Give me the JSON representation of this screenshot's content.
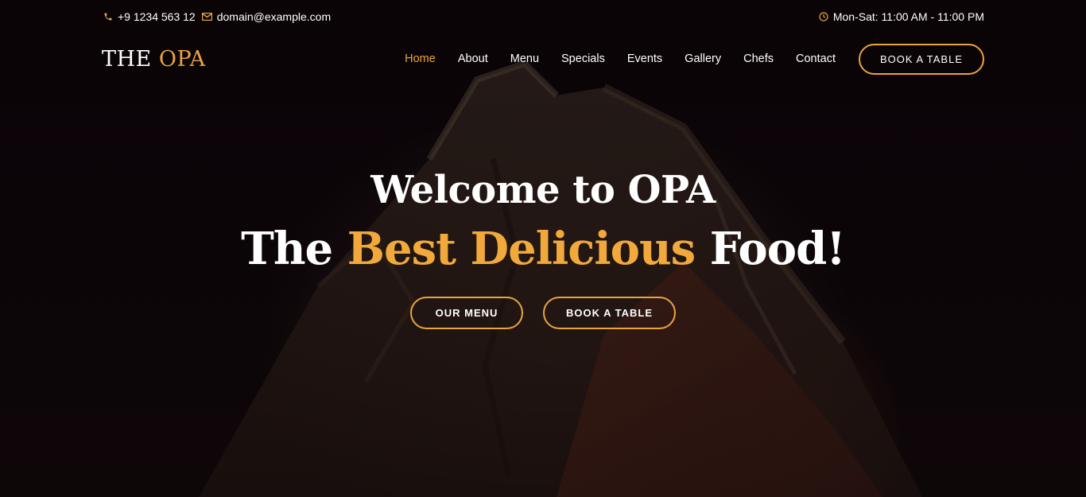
{
  "colors": {
    "accent": "#e9a43f",
    "background": "#0c0609",
    "text": "#ffffff"
  },
  "topbar": {
    "phone_icon": "phone-icon",
    "phone": "+9 1234 563 12",
    "email_icon": "envelope-icon",
    "email": "domain@example.com",
    "hours_icon": "clock-icon",
    "hours": "Mon-Sat: 11:00 AM - 11:00 PM"
  },
  "header": {
    "logo_main": "THE",
    "logo_accent": "OPA",
    "nav": [
      {
        "label": "Home",
        "active": true
      },
      {
        "label": "About"
      },
      {
        "label": "Menu"
      },
      {
        "label": "Specials"
      },
      {
        "label": "Events"
      },
      {
        "label": "Gallery"
      },
      {
        "label": "Chefs"
      },
      {
        "label": "Contact"
      }
    ],
    "book_button": "BOOK A TABLE"
  },
  "hero": {
    "line1": "Welcome to OPA",
    "line2_before": "The",
    "line2_accent": "Best Delicious",
    "line2_after": "Food!",
    "menu_button": "OUR MENU",
    "table_button": "BOOK A TABLE"
  }
}
